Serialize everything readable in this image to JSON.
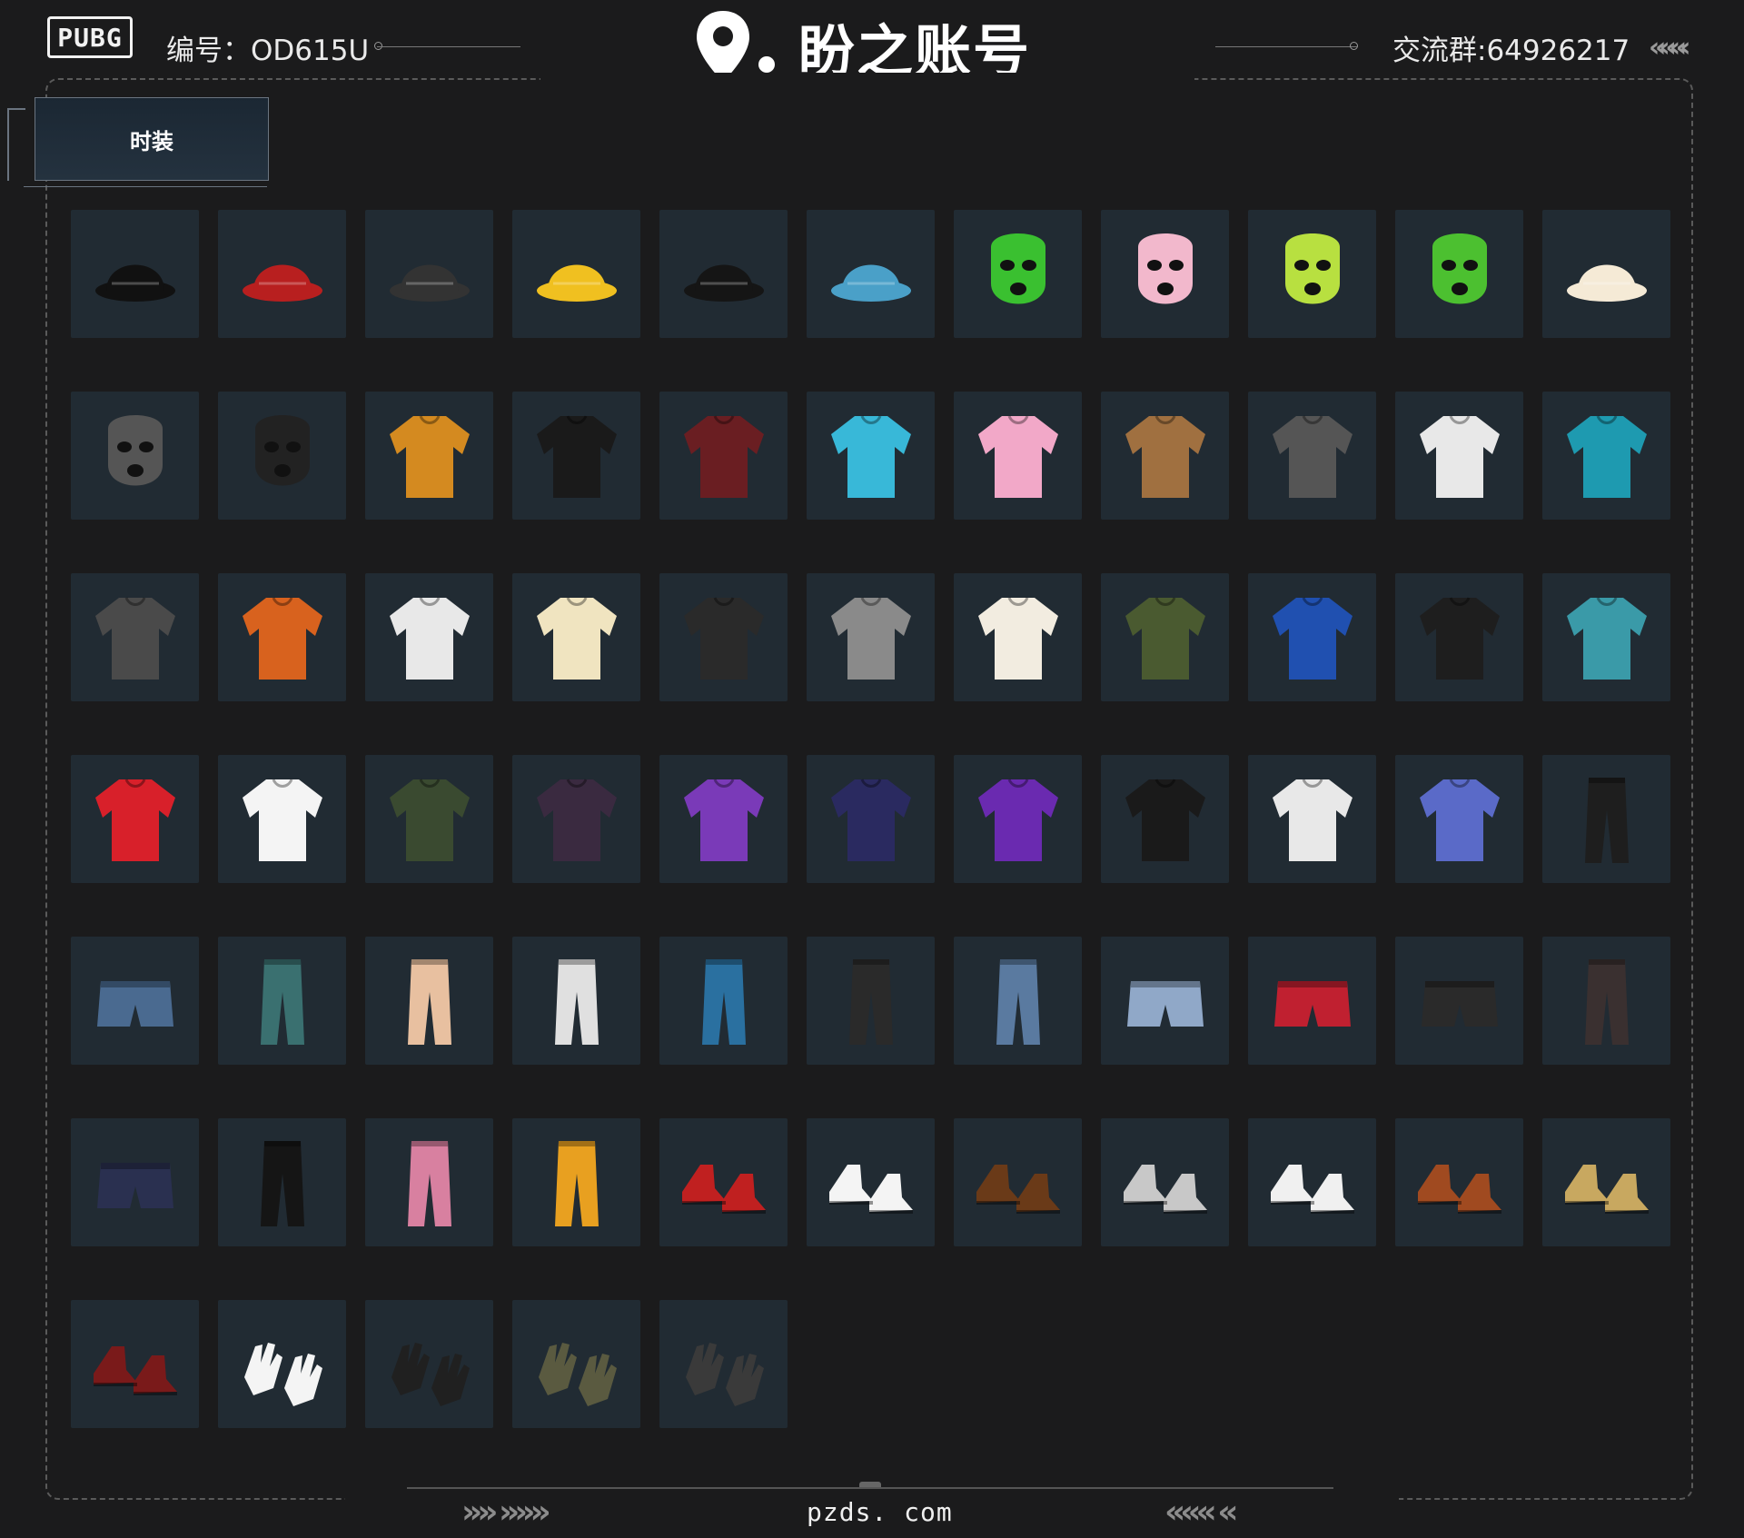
{
  "header": {
    "logo": "PUBG",
    "serial": "编号：OD615U",
    "brand": "盼之账号",
    "group": "交流群:64926217",
    "chevrons_right": "«««‹"
  },
  "tabs": [
    {
      "label": "时装",
      "active": true
    }
  ],
  "items": [
    {
      "icon": "bucket-hat",
      "color": "#111111"
    },
    {
      "icon": "knit-beanie",
      "color": "#b81f1f"
    },
    {
      "icon": "cat-ears",
      "color": "#333333"
    },
    {
      "icon": "flower-antenna",
      "color": "#f0c020"
    },
    {
      "icon": "baseball-cap",
      "color": "#151515"
    },
    {
      "icon": "dino-head",
      "color": "#4aa0c8"
    },
    {
      "icon": "frog-mask",
      "color": "#3ac030"
    },
    {
      "icon": "pink-face-mask",
      "color": "#f2b8cc"
    },
    {
      "icon": "balaclava",
      "color": "#b8e040"
    },
    {
      "icon": "alien-mask",
      "color": "#4cc030"
    },
    {
      "icon": "neck-pillow",
      "color": "#f5ead6"
    },
    {
      "icon": "bandana",
      "color": "#555555"
    },
    {
      "icon": "teeth-mask",
      "color": "#222222"
    },
    {
      "icon": "printed-tee",
      "color": "#d48a20"
    },
    {
      "icon": "racing-suit",
      "color": "#1a1a1a"
    },
    {
      "icon": "sports-bra-22",
      "color": "#6a1e22"
    },
    {
      "icon": "puffer-vest",
      "color": "#38b8d8"
    },
    {
      "icon": "pink-qipao",
      "color": "#f2a8c8"
    },
    {
      "icon": "gold-corset",
      "color": "#a07040"
    },
    {
      "icon": "tattoo-tee",
      "color": "#555555"
    },
    {
      "icon": "white-crop-top",
      "color": "#e8e8e8"
    },
    {
      "icon": "teal-tank",
      "color": "#1e9ab0"
    },
    {
      "icon": "grey-tattoo-shirt",
      "color": "#4a4a4a"
    },
    {
      "icon": "orange-tee",
      "color": "#d8621e"
    },
    {
      "icon": "cartoon-tee",
      "color": "#e8e8e8"
    },
    {
      "icon": "retro-tee",
      "color": "#f0e4c0"
    },
    {
      "icon": "tactical-vest",
      "color": "#2a2a2a"
    },
    {
      "icon": "grey-tee",
      "color": "#8a8a8a"
    },
    {
      "icon": "poster-tee",
      "color": "#f2ece0"
    },
    {
      "icon": "olive-turtleneck",
      "color": "#4a5a30"
    },
    {
      "icon": "color-block-jacket",
      "color": "#2050b0"
    },
    {
      "icon": "black-jacket",
      "color": "#1e1e1e"
    },
    {
      "icon": "duck-hoodie",
      "color": "#3a9aa8"
    },
    {
      "icon": "floral-vest",
      "color": "#d8202a"
    },
    {
      "icon": "bunny-tee",
      "color": "#f4f4f4"
    },
    {
      "icon": "bomber-jacket",
      "color": "#3a4a30"
    },
    {
      "icon": "leather-jacket",
      "color": "#3a2a40"
    },
    {
      "icon": "purple-windbreaker",
      "color": "#7a3ab8"
    },
    {
      "icon": "navy-sweater",
      "color": "#2a2a60"
    },
    {
      "icon": "purple-track-jacket",
      "color": "#6a2ab0"
    },
    {
      "icon": "black-hoodie",
      "color": "#1a1a1a"
    },
    {
      "icon": "astronaut-jacket",
      "color": "#e8e8e8"
    },
    {
      "icon": "gradient-hoodie",
      "color": "#5a6ac8"
    },
    {
      "icon": "black-cargo-pants",
      "color": "#1e1e1e"
    },
    {
      "icon": "denim-skirt",
      "color": "#4a6a90"
    },
    {
      "icon": "teal-shorts",
      "color": "#3a7070"
    },
    {
      "icon": "floral-pajama-pants",
      "color": "#e8c0a0"
    },
    {
      "icon": "white-jeans",
      "color": "#e0e0e0"
    },
    {
      "icon": "patch-jeans",
      "color": "#2a70a0"
    },
    {
      "icon": "black-ripped-jeans",
      "color": "#2a2a2a"
    },
    {
      "icon": "flare-jeans",
      "color": "#5a7aa0"
    },
    {
      "icon": "denim-shorts",
      "color": "#90a8c8"
    },
    {
      "icon": "red-briefs",
      "color": "#c02030"
    },
    {
      "icon": "black-skirt",
      "color": "#2a2a2a"
    },
    {
      "icon": "leather-pants",
      "color": "#3a3030"
    },
    {
      "icon": "suspender-shorts",
      "color": "#2a3050"
    },
    {
      "icon": "track-pants",
      "color": "#151515"
    },
    {
      "icon": "pink-leggings",
      "color": "#d880a0"
    },
    {
      "icon": "orange-pants",
      "color": "#e8a020"
    },
    {
      "icon": "red-sneakers",
      "color": "#c02020"
    },
    {
      "icon": "white-boots",
      "color": "#f4f4f4"
    },
    {
      "icon": "bear-paws",
      "color": "#6a3a18"
    },
    {
      "icon": "winged-sneakers",
      "color": "#c8c8c8"
    },
    {
      "icon": "white-heels",
      "color": "#f0f0f0"
    },
    {
      "icon": "brown-boots",
      "color": "#a04a20"
    },
    {
      "icon": "tan-boots",
      "color": "#c8a860"
    },
    {
      "icon": "burgundy-boots",
      "color": "#7a1a1a"
    },
    {
      "icon": "white-gloves",
      "color": "#f4f4f4"
    },
    {
      "icon": "black-gloves",
      "color": "#202020"
    },
    {
      "icon": "camo-gloves",
      "color": "#5a5a40"
    },
    {
      "icon": "hand-wraps",
      "color": "#3a3a3a"
    }
  ],
  "footer": {
    "url": "pzds. com",
    "chevrons_left": "»» »»»",
    "chevrons_right": "««« «"
  }
}
